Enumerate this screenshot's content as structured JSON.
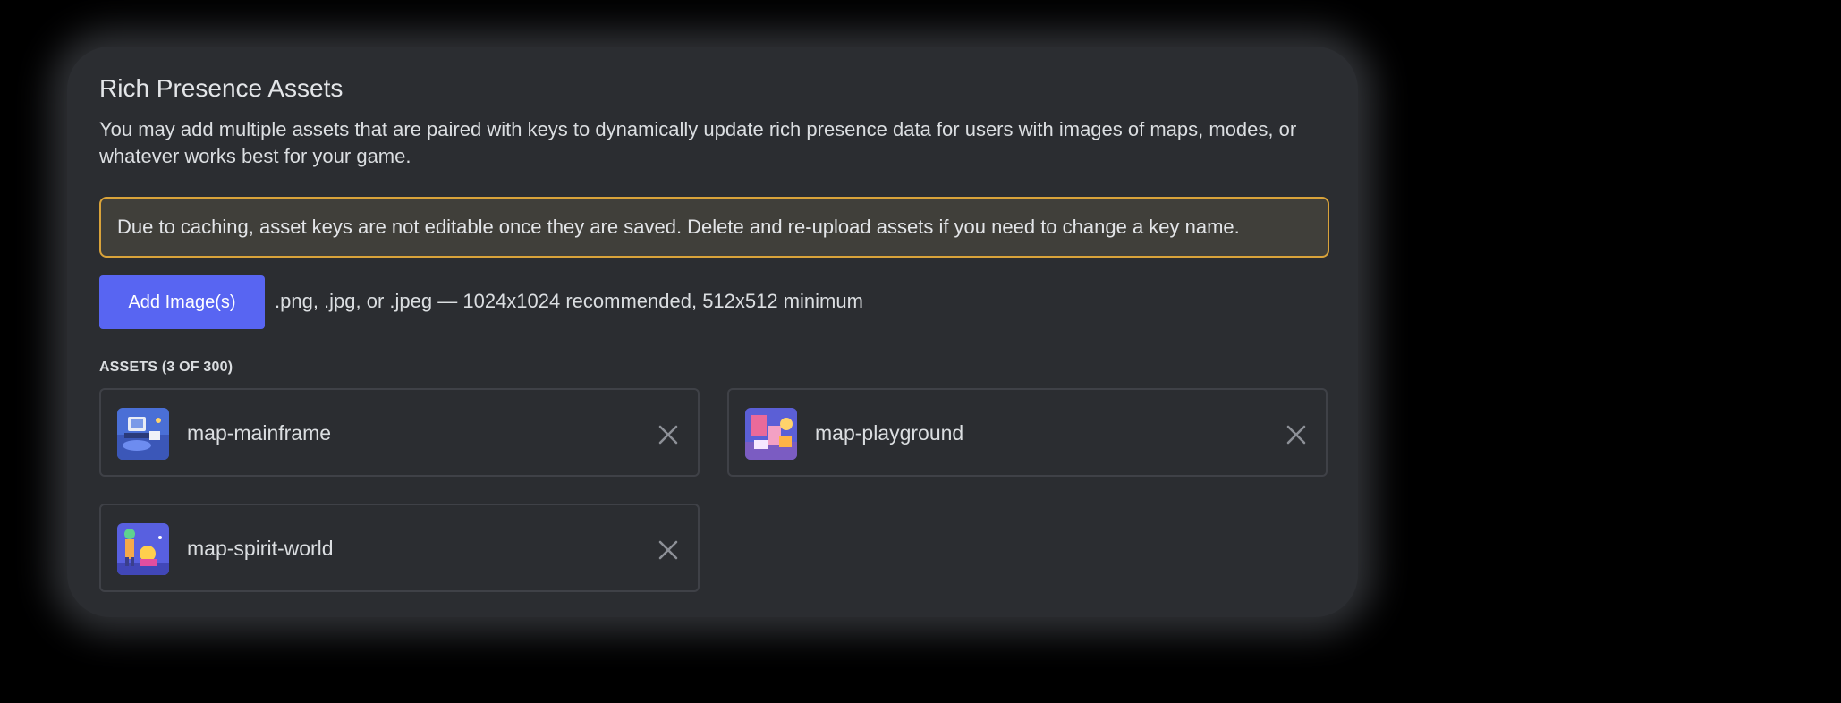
{
  "section": {
    "title": "Rich Presence Assets",
    "description": "You may add multiple assets that are paired with keys to dynamically update rich presence data for users with images of maps, modes, or whatever works best for your game."
  },
  "warning": {
    "text": "Due to caching, asset keys are not editable once they are saved. Delete and re-upload assets if you need to change a key name.",
    "border_color": "#d9a33a"
  },
  "upload": {
    "button_label": "Add Image(s)",
    "hint": ".png, .jpg, or .jpeg — 1024x1024 recommended, 512x512 minimum",
    "button_color": "#5865f2"
  },
  "assets": {
    "header": "ASSETS (3 OF 300)",
    "items": [
      {
        "name": "map-mainframe",
        "thumbnail": "mainframe-thumbnail",
        "remove_icon": "close-icon"
      },
      {
        "name": "map-playground",
        "thumbnail": "playground-thumbnail",
        "remove_icon": "close-icon"
      },
      {
        "name": "map-spirit-world",
        "thumbnail": "spirit-world-thumbnail",
        "remove_icon": "close-icon"
      }
    ]
  },
  "colors": {
    "panel_background": "#2b2d31",
    "text": "#dbdee1"
  }
}
